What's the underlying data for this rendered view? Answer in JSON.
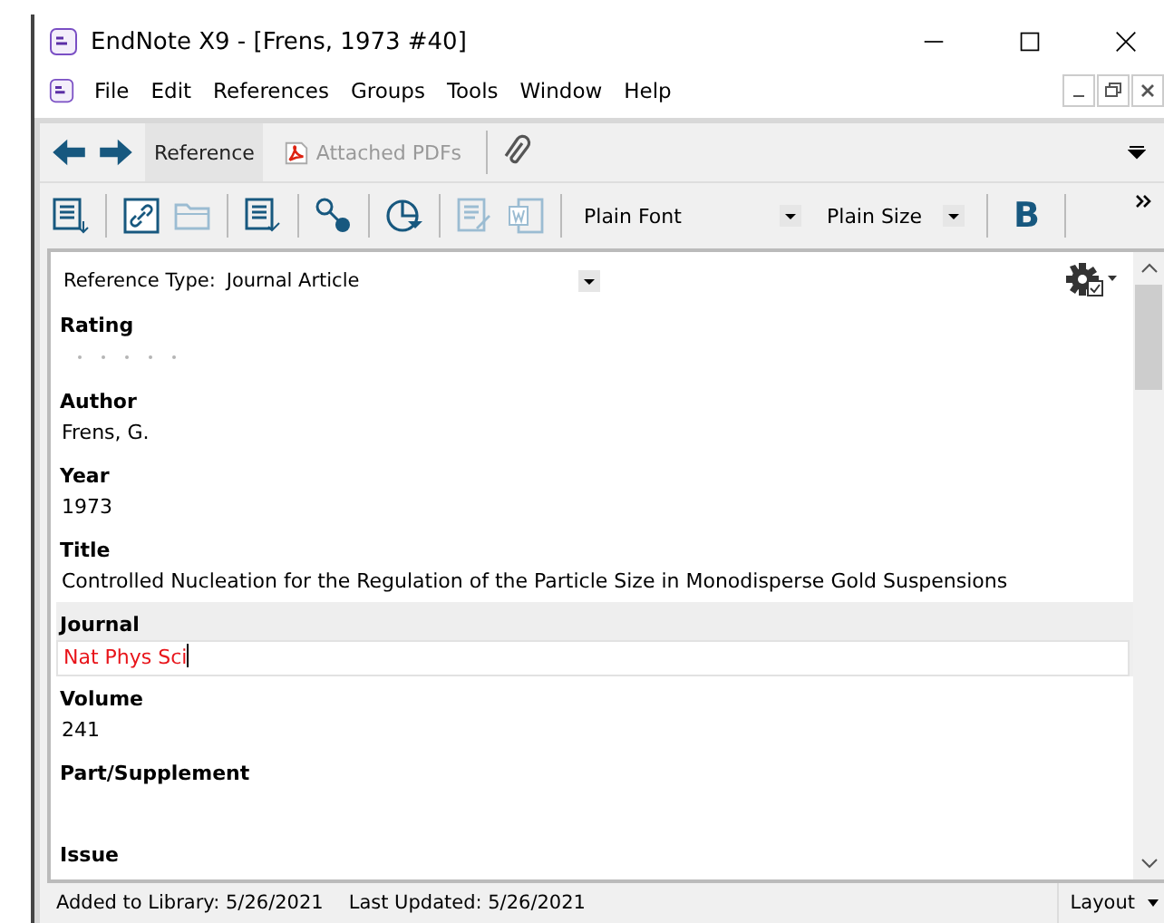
{
  "window": {
    "title": "EndNote X9 - [Frens, 1973 #40]"
  },
  "menu": [
    "File",
    "Edit",
    "References",
    "Groups",
    "Tools",
    "Window",
    "Help"
  ],
  "tabs": [
    {
      "label": "Reference",
      "selected": true,
      "kind": "text"
    },
    {
      "label": "Attached PDFs",
      "selected": false,
      "kind": "pdf"
    }
  ],
  "toolbar": {
    "font": "Plain Font",
    "size": "Plain Size",
    "bold": "B"
  },
  "reference_type": {
    "label": "Reference Type:",
    "value": "Journal Article"
  },
  "fields": [
    {
      "kind": "rating",
      "label": "Rating",
      "stars": 0,
      "selected": false
    },
    {
      "kind": "text",
      "label": "Author",
      "value": "Frens, G.",
      "selected": false
    },
    {
      "kind": "text",
      "label": "Year",
      "value": "1973",
      "selected": false
    },
    {
      "kind": "text",
      "label": "Title",
      "value": "Controlled Nucleation for the Regulation of the Particle Size in Monodisperse Gold Suspensions",
      "selected": false
    },
    {
      "kind": "text",
      "label": "Journal",
      "value": "Nat Phys Sci",
      "selected": true,
      "color": "#e8141a"
    },
    {
      "kind": "text",
      "label": "Volume",
      "value": "241",
      "selected": false
    },
    {
      "kind": "text",
      "label": "Part/Supplement",
      "selected": false
    },
    {
      "kind": "text",
      "label": "Issue",
      "selected": false
    }
  ],
  "status_bar": {
    "added": "Added to Library: 5/26/2021",
    "updated": "Last Updated: 5/26/2021",
    "layout": "Layout"
  }
}
